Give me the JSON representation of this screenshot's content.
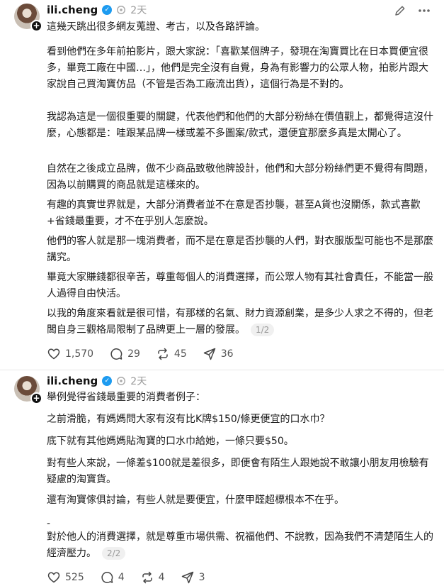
{
  "posts": [
    {
      "username": "ili.cheng",
      "time": "2天",
      "paragraphs": [
        "這幾天跳出很多網友蒐證、考古，以及各路評論。",
        "看到他們在多年前拍影片，跟大家說：「喜歡某個牌子，發現在淘寶買比在日本買便宜很多，畢竟工廠在中國…」，他們是完全沒有自覺，身為有影響力的公眾人物，拍影片跟大家說自己買淘寶仿品（不管是否為工廠流出貨），這個行為是不對的。",
        "我認為這是一個很重要的關鍵，代表他們和他們的大部分粉絲在價值觀上，都覺得這沒什麼，心態都是：哇跟某品牌一樣或差不多圖案/款式，還便宜那麼多真是太開心了。",
        "自然在之後成立品牌，做不少商品致敬他牌設計，他們和大部分粉絲們更不覺得有問題，因為以前購買的商品就是這樣來的。",
        "有趣的真實世界就是，大部分消費者並不在意是否抄襲，甚至A貨也沒關係，款式喜歡+省錢最重要，才不在乎別人怎麼說。",
        "他們的客人就是那一塊消費者，而不是在意是否抄襲的人們，對衣服版型可能也不是那麼講究。",
        "畢竟大家賺錢都很辛苦，尊重每個人的消費選擇，而公眾人物有其社會責任，不能當一般人過得自由快活。",
        "以我的角度來看就是很可惜，有那樣的名氣、財力資源創業，是多少人求之不得的，但老闆自身三觀格局限制了品牌更上一層的發展。"
      ],
      "page": "1/2",
      "likes": "1,570",
      "replies": "29",
      "reposts": "45",
      "shares": "36"
    },
    {
      "username": "ili.cheng",
      "time": "2天",
      "paragraphs": [
        "舉例覺得省錢最重要的消費者例子：",
        "之前滑脆，有媽媽問大家有沒有比K牌$150/條更便宜的口水巾？",
        "底下就有其他媽媽貼淘寶的口水巾給她，一條只要$50。",
        "對有些人來說，一條差$100就是差很多，即便會有陌生人跟她說不敢讓小朋友用檢驗有疑慮的淘寶貨。",
        "還有淘寶傢俱討論，有些人就是要便宜，什麼甲醛超標根本不在乎。",
        "-",
        "對於他人的消費選擇，就是尊重市場供需、祝福他們、不說教，因為我們不清楚陌生人的經濟壓力。"
      ],
      "page": "2/2",
      "likes": "525",
      "replies": "4",
      "reposts": "4",
      "shares": "3"
    }
  ]
}
